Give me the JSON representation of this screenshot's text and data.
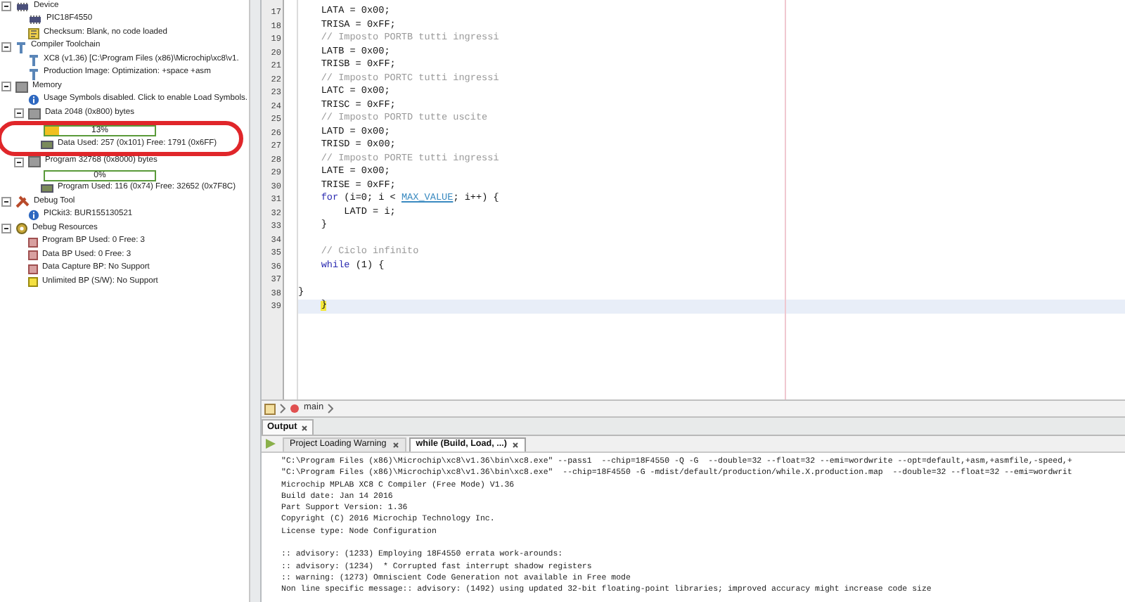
{
  "dashboard": {
    "items": [
      {
        "kind": "chip",
        "label": "Device",
        "expanded": true,
        "children": [
          {
            "kind": "chip",
            "label": "PIC18F4550"
          },
          {
            "kind": "checksum",
            "label": "Checksum: Blank, no code loaded"
          }
        ]
      },
      {
        "kind": "toolchain",
        "label": "Compiler Toolchain",
        "expanded": true,
        "children": [
          {
            "kind": "toolchain",
            "label": "XC8 (v1.36) [C:\\Program Files (x86)\\Microchip\\xc8\\v1."
          },
          {
            "kind": "toolchain",
            "label": "Production Image: Optimization: +space +asm"
          }
        ]
      },
      {
        "kind": "memory",
        "label": "Memory",
        "expanded": true,
        "children": [
          {
            "kind": "info",
            "label": "Usage Symbols disabled. Click to enable Load Symbols."
          },
          {
            "kind": "memory",
            "label": "Data 2048 (0x800) bytes",
            "expanded": true,
            "circled": true,
            "children": [
              {
                "kind": "meter",
                "level": 0.13,
                "reading": "13%"
              },
              {
                "kind": "ram",
                "label": "Data Used: 257 (0x101) Free: 1791 (0x6FF)"
              }
            ]
          },
          {
            "kind": "memory",
            "label": "Program 32768 (0x8000) bytes",
            "expanded": true,
            "children": [
              {
                "kind": "meter",
                "level": 0,
                "reading": "0%"
              },
              {
                "kind": "ram",
                "label": "Program Used: 116 (0x74) Free: 32652 (0x7F8C)"
              }
            ]
          }
        ]
      },
      {
        "kind": "debugger",
        "label": "Debug Tool",
        "expanded": true,
        "children": [
          {
            "kind": "info",
            "label": "PICkit3: BUR155130521"
          }
        ]
      },
      {
        "kind": "resources",
        "label": "Debug Resources",
        "expanded": true,
        "children": [
          {
            "kind": "breakpoint",
            "label": "Program BP Used: 0  Free: 3"
          },
          {
            "kind": "breakpoint",
            "label": "Data BP Used: 0  Free: 3"
          },
          {
            "kind": "breakpoint",
            "label": "Data Capture BP: No Support"
          },
          {
            "kind": "breakpoint-soft",
            "label": "Unlimited BP (S/W): No Support"
          }
        ]
      }
    ]
  },
  "editor": {
    "lines": [
      {
        "number": "17",
        "segments": [
          {
            "kind": "plain",
            "text": "    LATA = 0x00;"
          }
        ]
      },
      {
        "number": "18",
        "segments": [
          {
            "kind": "plain",
            "text": "    TRISA = 0xFF;"
          }
        ]
      },
      {
        "number": "19",
        "segments": [
          {
            "kind": "comment",
            "text": "    // Imposto PORTB tutti ingressi"
          }
        ]
      },
      {
        "number": "20",
        "segments": [
          {
            "kind": "plain",
            "text": "    LATB = 0x00;"
          }
        ]
      },
      {
        "number": "21",
        "segments": [
          {
            "kind": "plain",
            "text": "    TRISB = 0xFF;"
          }
        ]
      },
      {
        "number": "22",
        "segments": [
          {
            "kind": "comment",
            "text": "    // Imposto PORTC tutti ingressi"
          }
        ]
      },
      {
        "number": "23",
        "segments": [
          {
            "kind": "plain",
            "text": "    LATC = 0x00;"
          }
        ]
      },
      {
        "number": "24",
        "segments": [
          {
            "kind": "plain",
            "text": "    TRISC = 0xFF;"
          }
        ]
      },
      {
        "number": "25",
        "segments": [
          {
            "kind": "comment",
            "text": "    // Imposto PORTD tutte uscite"
          }
        ]
      },
      {
        "number": "26",
        "segments": [
          {
            "kind": "plain",
            "text": "    LATD = 0x00;"
          }
        ]
      },
      {
        "number": "27",
        "segments": [
          {
            "kind": "plain",
            "text": "    TRISD = 0x00;"
          }
        ]
      },
      {
        "number": "28",
        "segments": [
          {
            "kind": "comment",
            "text": "    // Imposto PORTE tutti ingressi"
          }
        ]
      },
      {
        "number": "29",
        "segments": [
          {
            "kind": "plain",
            "text": "    LATE = 0x00;"
          }
        ]
      },
      {
        "number": "30",
        "segments": [
          {
            "kind": "plain",
            "text": "    TRISE = 0xFF;"
          }
        ]
      },
      {
        "number": "31",
        "segments": [
          {
            "kind": "keyword",
            "text": "    for"
          },
          {
            "kind": "plain",
            "text": " (i=0; i < "
          },
          {
            "kind": "macro",
            "text": "MAX_VALUE"
          },
          {
            "kind": "plain",
            "text": "; i++) {"
          }
        ]
      },
      {
        "number": "32",
        "segments": [
          {
            "kind": "plain",
            "text": "        LATD = i;"
          }
        ]
      },
      {
        "number": "33",
        "segments": [
          {
            "kind": "plain",
            "text": "    }"
          }
        ]
      },
      {
        "number": "34"
      },
      {
        "number": "35",
        "segments": [
          {
            "kind": "comment",
            "text": "    // Ciclo infinito"
          }
        ]
      },
      {
        "number": "36",
        "segments": [
          {
            "kind": "keyword",
            "text": "    while"
          },
          {
            "kind": "plain",
            "text": " (1) {"
          }
        ]
      },
      {
        "number": "37"
      },
      {
        "number": "38",
        "segments": [
          {
            "kind": "plain",
            "text": "}"
          }
        ]
      },
      {
        "number": "39",
        "current": true,
        "segments": [
          {
            "kind": "match",
            "text": "    }"
          }
        ]
      }
    ]
  },
  "breadcrumb": {
    "items": [
      "main"
    ]
  },
  "output": {
    "title": "Output",
    "tabs": [
      {
        "label": "Project Loading Warning",
        "selected": false
      },
      {
        "label": "while (Build, Load, ...)",
        "selected": true
      }
    ],
    "blocks": [
      [
        "\"C:\\Program Files (x86)\\Microchip\\xc8\\v1.36\\bin\\xc8.exe\" --pass1  --chip=18F4550 -Q -G  --double=32 --float=32 --emi=wordwrite --opt=default,+asm,+asmfile,-speed,+",
        "\"C:\\Program Files (x86)\\Microchip\\xc8\\v1.36\\bin\\xc8.exe\"  --chip=18F4550 -G -mdist/default/production/while.X.production.map  --double=32 --float=32 --emi=wordwrit",
        "Microchip MPLAB XC8 C Compiler (Free Mode) V1.36",
        "Build date: Jan 14 2016",
        "Part Support Version: 1.36",
        "Copyright (C) 2016 Microchip Technology Inc.",
        "License type: Node Configuration"
      ],
      [
        ":: advisory: (1233) Employing 18F4550 errata work-arounds:",
        ":: advisory: (1234)  * Corrupted fast interrupt shadow registers",
        ":: warning: (1273) Omniscient Code Generation not available in Free mode",
        "Non line specific message:: advisory: (1492) using updated 32-bit floating-point libraries; improved accuracy might increase code size"
      ]
    ]
  }
}
